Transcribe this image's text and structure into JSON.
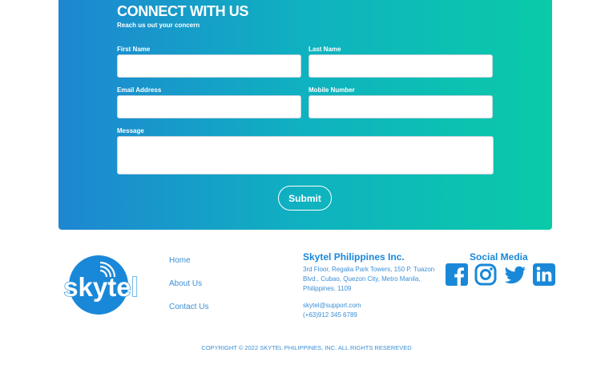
{
  "contact": {
    "title": "CONNECT WITH US",
    "subtitle": "Reach us out your concern",
    "first_name_label": "First Name",
    "last_name_label": "Last Name",
    "email_label": "Email Address",
    "mobile_label": "Mobile Number",
    "message_label": "Message",
    "first_name_value": "",
    "last_name_value": "",
    "email_value": "",
    "mobile_value": "",
    "message_value": "",
    "submit_label": "Submit"
  },
  "brand": {
    "logo_text": "skytel",
    "logo_color": "#1a88d8"
  },
  "nav": {
    "items": [
      {
        "label": "Home"
      },
      {
        "label": "About Us"
      },
      {
        "label": "Contact Us"
      }
    ]
  },
  "company": {
    "name": "Skytel Philippines Inc.",
    "address": "3rd Floor, Regalia Park Towers, 150 P. Tuazon Blvd., Cubao, Quezon City, Metro Manila, Philippines. 1109",
    "email": "skytel@support.com",
    "phone": "(+63)912 345 6789"
  },
  "social": {
    "title": "Social Media",
    "icons": [
      "facebook-icon",
      "instagram-icon",
      "twitter-icon",
      "linkedin-icon"
    ]
  },
  "footer": {
    "copyright": "COPYRIGHT © 2022 SKYTEL PHILIPPINES, INC. ALL RIGHTS RESEREVED"
  },
  "colors": {
    "gradient_start": "#1e86d2",
    "gradient_end": "#0acaa8",
    "accent_blue": "#1a88d8"
  }
}
